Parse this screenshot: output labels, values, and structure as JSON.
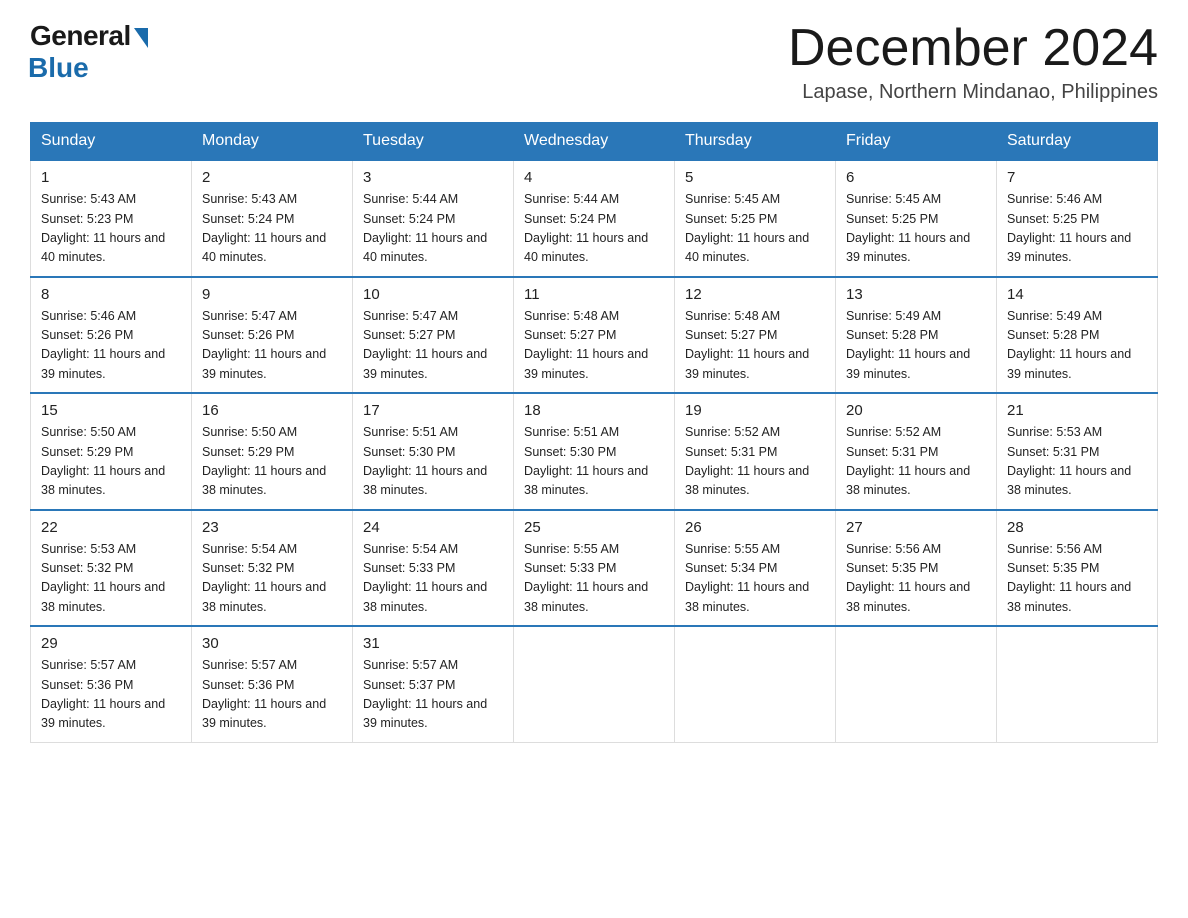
{
  "logo": {
    "general": "General",
    "blue": "Blue"
  },
  "title": "December 2024",
  "location": "Lapase, Northern Mindanao, Philippines",
  "days_of_week": [
    "Sunday",
    "Monday",
    "Tuesday",
    "Wednesday",
    "Thursday",
    "Friday",
    "Saturday"
  ],
  "weeks": [
    [
      {
        "day": "1",
        "sunrise": "5:43 AM",
        "sunset": "5:23 PM",
        "daylight": "11 hours and 40 minutes."
      },
      {
        "day": "2",
        "sunrise": "5:43 AM",
        "sunset": "5:24 PM",
        "daylight": "11 hours and 40 minutes."
      },
      {
        "day": "3",
        "sunrise": "5:44 AM",
        "sunset": "5:24 PM",
        "daylight": "11 hours and 40 minutes."
      },
      {
        "day": "4",
        "sunrise": "5:44 AM",
        "sunset": "5:24 PM",
        "daylight": "11 hours and 40 minutes."
      },
      {
        "day": "5",
        "sunrise": "5:45 AM",
        "sunset": "5:25 PM",
        "daylight": "11 hours and 40 minutes."
      },
      {
        "day": "6",
        "sunrise": "5:45 AM",
        "sunset": "5:25 PM",
        "daylight": "11 hours and 39 minutes."
      },
      {
        "day": "7",
        "sunrise": "5:46 AM",
        "sunset": "5:25 PM",
        "daylight": "11 hours and 39 minutes."
      }
    ],
    [
      {
        "day": "8",
        "sunrise": "5:46 AM",
        "sunset": "5:26 PM",
        "daylight": "11 hours and 39 minutes."
      },
      {
        "day": "9",
        "sunrise": "5:47 AM",
        "sunset": "5:26 PM",
        "daylight": "11 hours and 39 minutes."
      },
      {
        "day": "10",
        "sunrise": "5:47 AM",
        "sunset": "5:27 PM",
        "daylight": "11 hours and 39 minutes."
      },
      {
        "day": "11",
        "sunrise": "5:48 AM",
        "sunset": "5:27 PM",
        "daylight": "11 hours and 39 minutes."
      },
      {
        "day": "12",
        "sunrise": "5:48 AM",
        "sunset": "5:27 PM",
        "daylight": "11 hours and 39 minutes."
      },
      {
        "day": "13",
        "sunrise": "5:49 AM",
        "sunset": "5:28 PM",
        "daylight": "11 hours and 39 minutes."
      },
      {
        "day": "14",
        "sunrise": "5:49 AM",
        "sunset": "5:28 PM",
        "daylight": "11 hours and 39 minutes."
      }
    ],
    [
      {
        "day": "15",
        "sunrise": "5:50 AM",
        "sunset": "5:29 PM",
        "daylight": "11 hours and 38 minutes."
      },
      {
        "day": "16",
        "sunrise": "5:50 AM",
        "sunset": "5:29 PM",
        "daylight": "11 hours and 38 minutes."
      },
      {
        "day": "17",
        "sunrise": "5:51 AM",
        "sunset": "5:30 PM",
        "daylight": "11 hours and 38 minutes."
      },
      {
        "day": "18",
        "sunrise": "5:51 AM",
        "sunset": "5:30 PM",
        "daylight": "11 hours and 38 minutes."
      },
      {
        "day": "19",
        "sunrise": "5:52 AM",
        "sunset": "5:31 PM",
        "daylight": "11 hours and 38 minutes."
      },
      {
        "day": "20",
        "sunrise": "5:52 AM",
        "sunset": "5:31 PM",
        "daylight": "11 hours and 38 minutes."
      },
      {
        "day": "21",
        "sunrise": "5:53 AM",
        "sunset": "5:31 PM",
        "daylight": "11 hours and 38 minutes."
      }
    ],
    [
      {
        "day": "22",
        "sunrise": "5:53 AM",
        "sunset": "5:32 PM",
        "daylight": "11 hours and 38 minutes."
      },
      {
        "day": "23",
        "sunrise": "5:54 AM",
        "sunset": "5:32 PM",
        "daylight": "11 hours and 38 minutes."
      },
      {
        "day": "24",
        "sunrise": "5:54 AM",
        "sunset": "5:33 PM",
        "daylight": "11 hours and 38 minutes."
      },
      {
        "day": "25",
        "sunrise": "5:55 AM",
        "sunset": "5:33 PM",
        "daylight": "11 hours and 38 minutes."
      },
      {
        "day": "26",
        "sunrise": "5:55 AM",
        "sunset": "5:34 PM",
        "daylight": "11 hours and 38 minutes."
      },
      {
        "day": "27",
        "sunrise": "5:56 AM",
        "sunset": "5:35 PM",
        "daylight": "11 hours and 38 minutes."
      },
      {
        "day": "28",
        "sunrise": "5:56 AM",
        "sunset": "5:35 PM",
        "daylight": "11 hours and 38 minutes."
      }
    ],
    [
      {
        "day": "29",
        "sunrise": "5:57 AM",
        "sunset": "5:36 PM",
        "daylight": "11 hours and 39 minutes."
      },
      {
        "day": "30",
        "sunrise": "5:57 AM",
        "sunset": "5:36 PM",
        "daylight": "11 hours and 39 minutes."
      },
      {
        "day": "31",
        "sunrise": "5:57 AM",
        "sunset": "5:37 PM",
        "daylight": "11 hours and 39 minutes."
      },
      null,
      null,
      null,
      null
    ]
  ]
}
